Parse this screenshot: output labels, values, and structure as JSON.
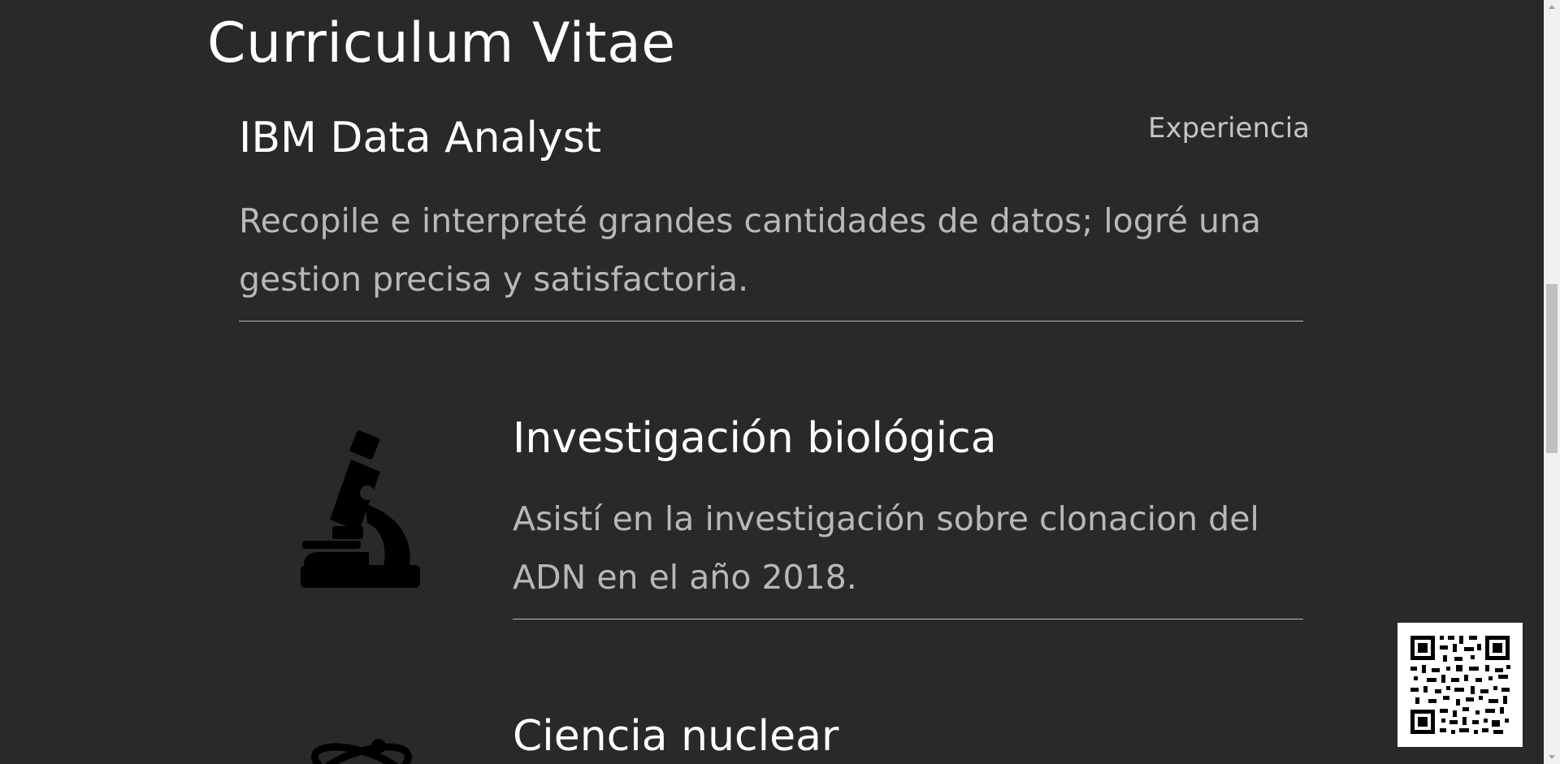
{
  "page": {
    "title": "Curriculum Vitae",
    "section_tag": "Experiencia"
  },
  "entries": [
    {
      "title": "IBM Data Analyst",
      "description_line1": "Recopile e interpreté grandes cantidades de datos; logré una",
      "description_line2": "gestion precisa y satisfactoria."
    },
    {
      "title": "Investigación biológica",
      "icon": "microscope-icon",
      "description_line1": "Asistí en la investigación sobre clonacion del",
      "description_line2": "ADN en el año 2018."
    },
    {
      "title": "Ciencia nuclear",
      "icon": "atom-icon"
    }
  ],
  "colors": {
    "background": "#292929",
    "heading": "#ffffff",
    "body_text": "#b8b8b8",
    "divider": "#bdbdbd",
    "icon": "#000000"
  },
  "widgets": {
    "qr_code": "qr-code"
  }
}
